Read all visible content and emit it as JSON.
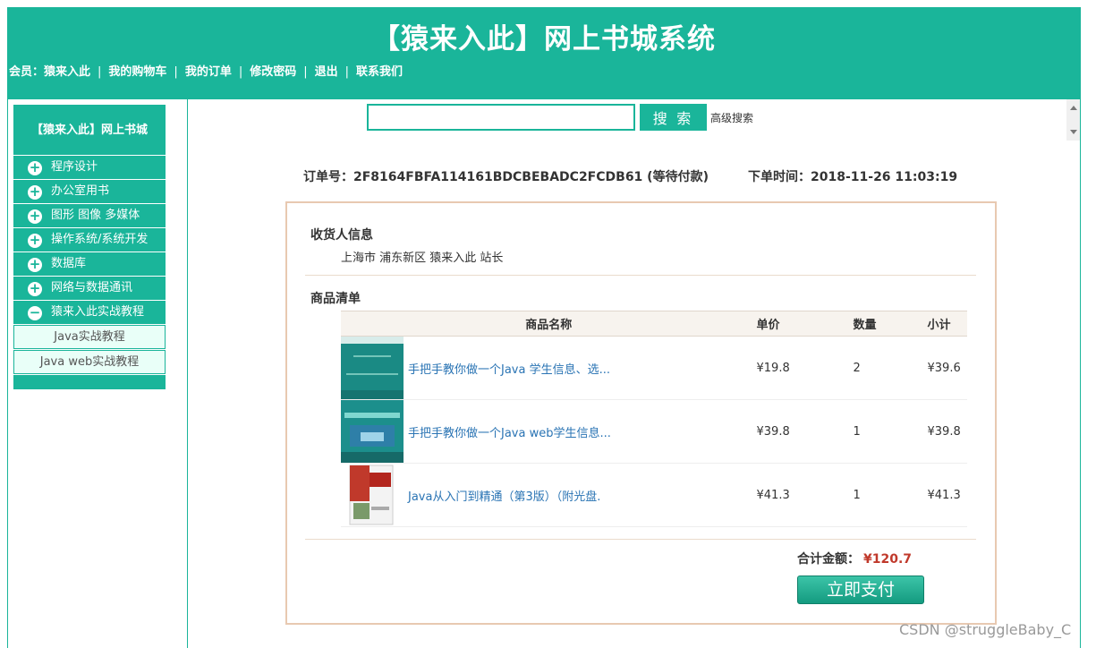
{
  "header": {
    "title": "【猿来入此】网上书城系统",
    "nav": {
      "member": "会员：猿来入此",
      "links": [
        "我的购物车",
        "我的订单",
        "修改密码",
        "退出",
        "联系我们"
      ],
      "sep": "|"
    }
  },
  "sidebar": {
    "title": "【猿来入此】网上书城",
    "categories": [
      {
        "label": "程序设计",
        "icon": "plus-icon"
      },
      {
        "label": "办公室用书",
        "icon": "plus-icon"
      },
      {
        "label": "图形 图像 多媒体",
        "icon": "plus-icon"
      },
      {
        "label": "操作系统/系统开发",
        "icon": "plus-icon"
      },
      {
        "label": "数据库",
        "icon": "plus-icon"
      },
      {
        "label": "网络与数据通讯",
        "icon": "plus-icon"
      },
      {
        "label": "猿来入此实战教程",
        "icon": "minus-icon"
      }
    ],
    "subitems": [
      "Java实战教程",
      "Java web实战教程"
    ],
    "icon_glyphs": {
      "plus": "+",
      "minus": "−"
    }
  },
  "search": {
    "value": "",
    "button": "搜 索",
    "advanced": "高级搜索"
  },
  "order": {
    "number_line": "订单号：2F8164FBFA114161BDCBEBADC2FCDB61 (等待付款)",
    "time_line": "下单时间：2018-11-26 11:03:19",
    "receiver_title": "收货人信息",
    "address": "上海市 浦东新区 猿来入此 站长",
    "list_title": "商品清单",
    "columns": [
      "商品名称",
      "单价",
      "数量",
      "小计"
    ],
    "items": [
      {
        "name": "手把手教你做一个Java 学生信息、选...",
        "price": "¥19.8",
        "qty": "2",
        "subtotal": "¥39.6",
        "cover": "cover-java-student"
      },
      {
        "name": "手把手教你做一个Java web学生信息...",
        "price": "¥39.8",
        "qty": "1",
        "subtotal": "¥39.8",
        "cover": "cover-javaweb-student"
      },
      {
        "name": "Java从入门到精通（第3版）（附光盘.",
        "price": "¥41.3",
        "qty": "1",
        "subtotal": "¥41.3",
        "cover": "cover-java-book"
      }
    ],
    "total_label": "合计金额：",
    "total_value": "¥120.7",
    "pay_button": "立即支付"
  },
  "watermark": "CSDN @struggleBaby_C",
  "colors": {
    "accent": "#1ab59a",
    "price_red": "#c0392b",
    "link_blue": "#2a74b4",
    "box_border": "#e8c9b1"
  }
}
